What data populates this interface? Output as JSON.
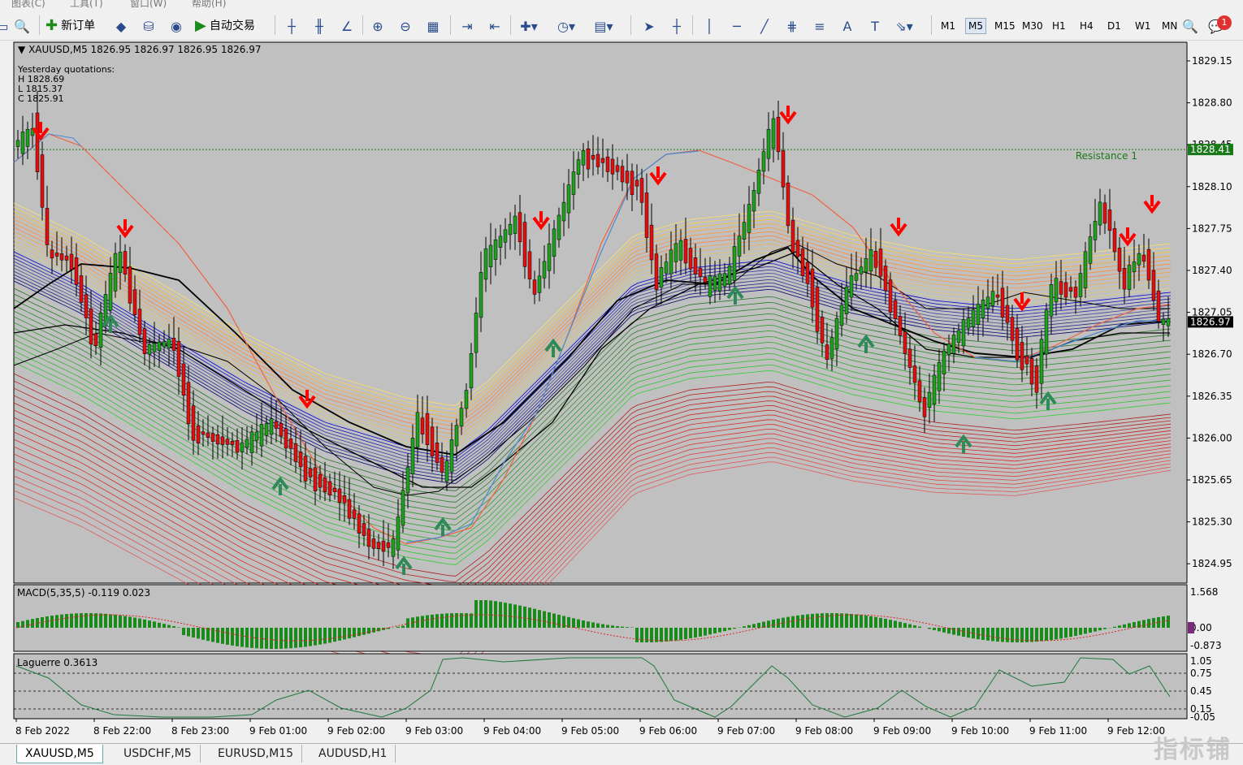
{
  "menu": [
    "图表(C)",
    "工具(T)",
    "窗口(W)",
    "帮助(H)"
  ],
  "toolbar": {
    "new_order": "新订单",
    "auto_trading": "自动交易",
    "timeframes": [
      "M1",
      "M5",
      "M15",
      "M30",
      "H1",
      "H4",
      "D1",
      "W1",
      "MN"
    ],
    "active_timeframe": "M5",
    "notification_count": "1"
  },
  "chart": {
    "header": "XAUUSD,M5  1826.95 1826.97 1826.95 1826.97",
    "yesterday_title": "Yesterday quotations:",
    "yesterday_h": "H 1828.69",
    "yesterday_l": "L 1815.37",
    "yesterday_c": "C 1825.91",
    "resistance_label": "Resistance 1",
    "resistance_price": "1828.41",
    "current_price": "1826.97",
    "price_ticks": [
      "1829.15",
      "1828.80",
      "1828.45",
      "1828.10",
      "1827.75",
      "1827.40",
      "1827.05",
      "1826.70",
      "1826.35",
      "1826.00",
      "1825.65",
      "1825.30",
      "1824.95"
    ],
    "time_ticks": [
      "8 Feb 2022",
      "8 Feb 22:00",
      "8 Feb 23:00",
      "9 Feb 01:00",
      "9 Feb 02:00",
      "9 Feb 03:00",
      "9 Feb 04:00",
      "9 Feb 05:00",
      "9 Feb 06:00",
      "9 Feb 07:00",
      "9 Feb 08:00",
      "9 Feb 09:00",
      "9 Feb 10:00",
      "9 Feb 11:00",
      "9 Feb 12:00"
    ],
    "colors": {
      "background": "#c0c0c0",
      "up_candle": "#1fa01f",
      "down_candle": "#e01010",
      "buy_arrow": "#2e8b57",
      "sell_arrow": "#ff0000"
    }
  },
  "macd": {
    "label": "MACD(5,35,5) -0.119 0.023",
    "ticks": [
      "1.568",
      "0.00",
      "-0.873"
    ]
  },
  "laguerre": {
    "label": "Laguerre 0.3613",
    "ticks": [
      "1.05",
      "0.75",
      "0.45",
      "0.15",
      "-0.05"
    ]
  },
  "tabs": [
    "XAUUSD,M5",
    "USDCHF,M5",
    "EURUSD,M15",
    "AUDUSD,H1"
  ],
  "watermark": "指标铺"
}
